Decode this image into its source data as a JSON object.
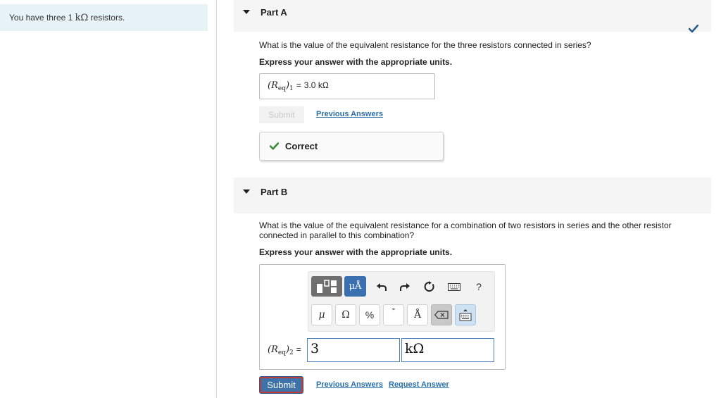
{
  "intro": {
    "text_before": "You have three 1 ",
    "unit": "kΩ",
    "text_after": " resistors."
  },
  "part_a": {
    "title": "Part A",
    "status_icon": "checkmark-icon",
    "question": "What is the value of the equivalent resistance for the three resistors connected in series?",
    "instruction": "Express your answer with the appropriate units.",
    "label_var": "R",
    "label_sub": "eq",
    "label_index": "1",
    "answer": "3.0 kΩ",
    "submit_label": "Submit",
    "previous_answers_link": "Previous Answers",
    "feedback": "Correct"
  },
  "part_b": {
    "title": "Part B",
    "question": "What is the value of the equivalent resistance for a combination of two resistors in series and the other resistor connected in parallel to this combination?",
    "instruction": "Express your answer with the appropriate units.",
    "toolbar": {
      "units_button": "μÅ",
      "symbols": [
        "μ",
        "Ω",
        "%",
        "°",
        "Å"
      ],
      "help": "?"
    },
    "label_var": "R",
    "label_sub": "eq",
    "label_index": "2",
    "value_input": "3",
    "units_input": "kΩ",
    "submit_label": "Submit",
    "previous_answers_link": "Previous Answers",
    "request_answer_link": "Request Answer"
  },
  "colors": {
    "accent_blue": "#3d73a9",
    "correct_green": "#3a8a3a",
    "intro_bg": "#e8f3f7",
    "link": "#2a6fa8"
  }
}
